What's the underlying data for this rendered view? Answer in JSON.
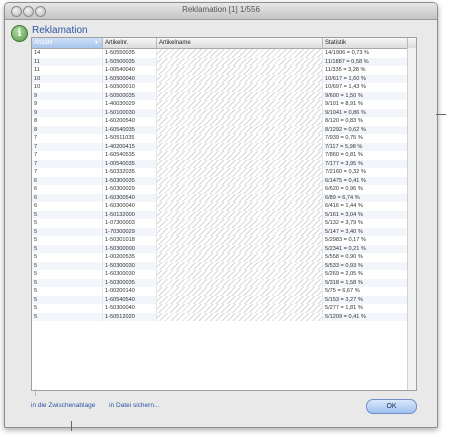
{
  "window": {
    "title": "Reklamation [1] 1/556"
  },
  "header": {
    "title": "Reklamation"
  },
  "table": {
    "columns": [
      "Anzahl",
      "Artikelnr.",
      "Artikelname",
      "Statistik"
    ],
    "rows": [
      [
        "14",
        "1-50550035",
        "",
        "14/1906 = 0,73 %"
      ],
      [
        "11",
        "1-50500035",
        "",
        "11/1887 = 0,58 %"
      ],
      [
        "11",
        "1-00540040",
        "",
        "11/335 = 3,28 %"
      ],
      [
        "10",
        "1-50500040",
        "",
        "10/617 = 1,60 %"
      ],
      [
        "10",
        "1-50500010",
        "",
        "10/697 = 1,43 %"
      ],
      [
        "9",
        "1-50500035",
        "",
        "9/600 = 1,50 %"
      ],
      [
        "9",
        "1-40030029",
        "",
        "9/101 = 8,91 %"
      ],
      [
        "9",
        "1-50100030",
        "",
        "9/1041 = 0,86 %"
      ],
      [
        "8",
        "1-60200540",
        "",
        "8/120 = 0,83 %"
      ],
      [
        "8",
        "1-60540035",
        "",
        "8/1292 = 0,62 %"
      ],
      [
        "7",
        "1-50511035",
        "",
        "7/939 = 0,75 %"
      ],
      [
        "7",
        "1-40200415",
        "",
        "7/117 = 5,98 %"
      ],
      [
        "7",
        "1-60540535",
        "",
        "7/860 = 0,81 %"
      ],
      [
        "7",
        "1-00540035",
        "",
        "7/177 = 3,95 %"
      ],
      [
        "7",
        "1-50332035",
        "",
        "7/2160 = 0,32 %"
      ],
      [
        "6",
        "1-50300035",
        "",
        "6/1475 = 0,41 %"
      ],
      [
        "6",
        "1-50300029",
        "",
        "6/620 = 0,96 %"
      ],
      [
        "6",
        "1-60300540",
        "",
        "6/89 = 6,74 %"
      ],
      [
        "6",
        "1-60300040",
        "",
        "6/416 = 1,44 %"
      ],
      [
        "5",
        "1-50132000",
        "",
        "5/161 = 3,04 %"
      ],
      [
        "5",
        "1-07300003",
        "",
        "5/132 = 3,79 %"
      ],
      [
        "5",
        "1-70300029",
        "",
        "5/147 = 3,40 %"
      ],
      [
        "5",
        "1-50301018",
        "",
        "5/2983 = 0,17 %"
      ],
      [
        "5",
        "1-50300000",
        "",
        "5/2341 = 0,21 %"
      ],
      [
        "5",
        "1-00200535",
        "",
        "5/558 = 0,90 %"
      ],
      [
        "5",
        "1-50300030",
        "",
        "5/533 = 0,93 %"
      ],
      [
        "5",
        "1-60300030",
        "",
        "5/269 = 2,05 %"
      ],
      [
        "5",
        "1-50300035",
        "",
        "5/318 = 1,58 %"
      ],
      [
        "5",
        "1-00200140",
        "",
        "5/75 = 6,67 %"
      ],
      [
        "5",
        "1-60540540",
        "",
        "5/153 = 3,27 %"
      ],
      [
        "5",
        "1-50300040",
        "",
        "5/277 = 1,81 %"
      ],
      [
        "5",
        "1-50512020",
        "",
        "5/1209 = 0,41 %"
      ]
    ]
  },
  "footer": {
    "link1": "in die Zwischenablage",
    "link2": "in Datei sichern..."
  },
  "buttons": {
    "ok": "OK"
  },
  "colors": {
    "accent": "#2b56a3",
    "button": "#9fc0ef"
  }
}
